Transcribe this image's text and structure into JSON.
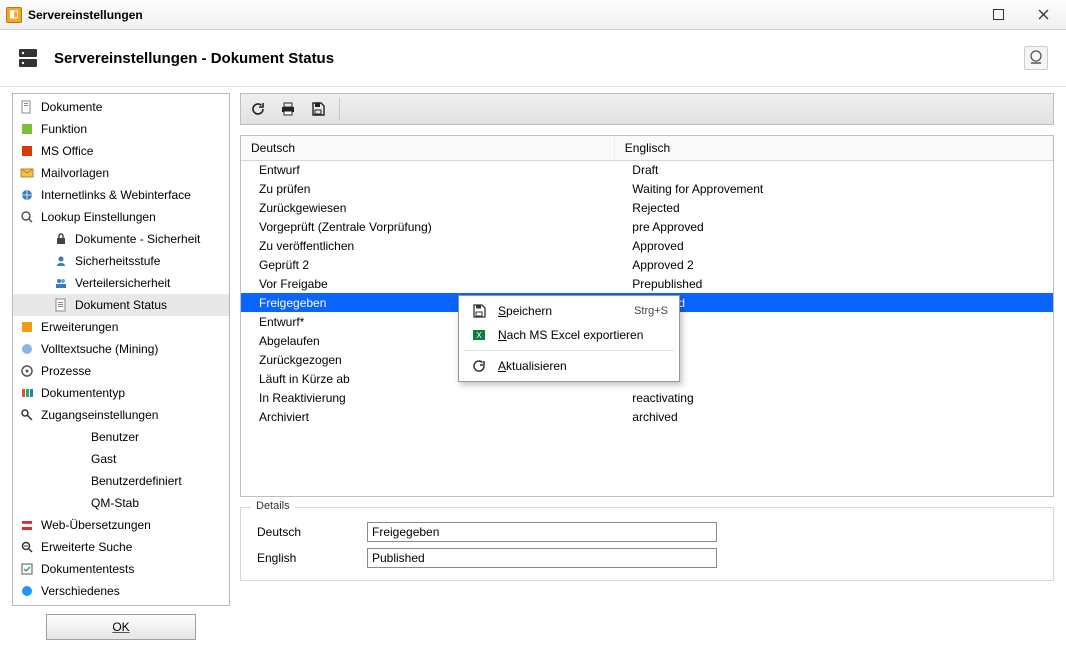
{
  "window": {
    "title": "Servereinstellungen"
  },
  "header": {
    "title": "Servereinstellungen - Dokument Status"
  },
  "sidebar": {
    "items": [
      {
        "label": "Dokumente",
        "level": 0,
        "icon": "document-icon"
      },
      {
        "label": "Funktion",
        "level": 0,
        "icon": "puzzle-icon"
      },
      {
        "label": "MS Office",
        "level": 0,
        "icon": "office-icon"
      },
      {
        "label": "Mailvorlagen",
        "level": 0,
        "icon": "mail-icon"
      },
      {
        "label": "Internetlinks & Webinterface",
        "level": 0,
        "icon": "globe-icon"
      },
      {
        "label": "Lookup Einstellungen",
        "level": 0,
        "icon": "search-icon"
      },
      {
        "label": "Dokumente - Sicherheit",
        "level": 1,
        "icon": "lock-icon"
      },
      {
        "label": "Sicherheitsstufe",
        "level": 1,
        "icon": "person-icon"
      },
      {
        "label": "Verteilersicherheit",
        "level": 1,
        "icon": "people-icon"
      },
      {
        "label": "Dokument Status",
        "level": 1,
        "icon": "docstatus-icon",
        "selected": true
      },
      {
        "label": "Erweiterungen",
        "level": 0,
        "icon": "plugin-icon"
      },
      {
        "label": "Volltextsuche (Mining)",
        "level": 0,
        "icon": "mining-icon"
      },
      {
        "label": "Prozesse",
        "level": 0,
        "icon": "process-icon"
      },
      {
        "label": "Dokumententyp",
        "level": 0,
        "icon": "doctype-icon"
      },
      {
        "label": "Zugangseinstellungen",
        "level": 0,
        "icon": "key-icon"
      },
      {
        "label": "Benutzer",
        "level": 2,
        "icon": ""
      },
      {
        "label": "Gast",
        "level": 2,
        "icon": ""
      },
      {
        "label": "Benutzerdefiniert",
        "level": 2,
        "icon": ""
      },
      {
        "label": "QM-Stab",
        "level": 2,
        "icon": ""
      },
      {
        "label": "Web-Übersetzungen",
        "level": 0,
        "icon": "flag-icon"
      },
      {
        "label": "Erweiterte Suche",
        "level": 0,
        "icon": "advsearch-icon"
      },
      {
        "label": "Dokumententests",
        "level": 0,
        "icon": "test-icon"
      },
      {
        "label": "Verschiedenes",
        "level": 0,
        "icon": "misc-icon"
      }
    ]
  },
  "ok_label": "OK",
  "table": {
    "headers": {
      "de": "Deutsch",
      "en": "Englisch"
    },
    "rows": [
      {
        "de": "Entwurf",
        "en": "Draft"
      },
      {
        "de": "Zu prüfen",
        "en": "Waiting for Approvement"
      },
      {
        "de": "Zurückgewiesen",
        "en": "Rejected"
      },
      {
        "de": "Vorgeprüft (Zentrale Vorprüfung)",
        "en": "pre Approved"
      },
      {
        "de": "Zu veröffentlichen",
        "en": "Approved"
      },
      {
        "de": "Geprüft 2",
        "en": "Approved 2"
      },
      {
        "de": "Vor Freigabe",
        "en": "Prepublished"
      },
      {
        "de": "Freigegeben",
        "en": "Published",
        "selected": true
      },
      {
        "de": "Entwurf*",
        "en": ""
      },
      {
        "de": "Abgelaufen",
        "en": ""
      },
      {
        "de": "Zurückgezogen",
        "en": ""
      },
      {
        "de": "Läuft in Kürze ab",
        "en": ""
      },
      {
        "de": "In Reaktivierung",
        "en": "reactivating"
      },
      {
        "de": "Archiviert",
        "en": "archived"
      }
    ]
  },
  "details": {
    "legend": "Details",
    "de_label": "Deutsch",
    "en_label": "English",
    "de_value": "Freigegeben",
    "en_value": "Published"
  },
  "context_menu": {
    "items": [
      {
        "label": "Speichern",
        "underline_index": 0,
        "shortcut": "Strg+S",
        "icon": "save-icon"
      },
      {
        "label": "Nach MS Excel exportieren",
        "underline_index": 0,
        "shortcut": "",
        "icon": "excel-icon"
      },
      {
        "sep": true
      },
      {
        "label": "Aktualisieren",
        "underline_index": 0,
        "shortcut": "",
        "icon": "refresh-icon"
      }
    ]
  }
}
